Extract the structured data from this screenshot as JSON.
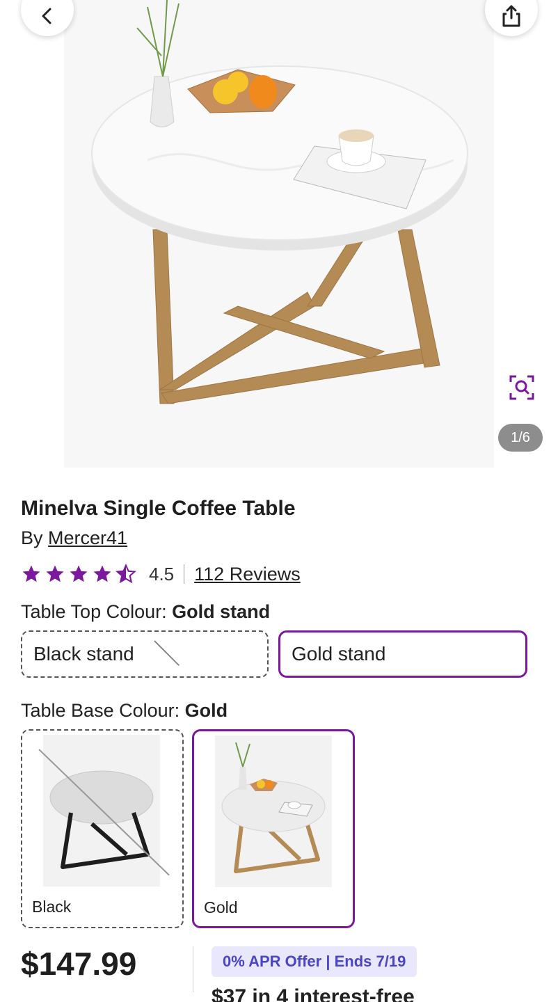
{
  "colors": {
    "accent": "#7b189f",
    "apr_text": "#4a44c6",
    "apr_bg": "#e8e7fb",
    "star": "#7b189f"
  },
  "hero": {
    "back_icon": "chevron-left-icon",
    "share_icon": "share-icon",
    "zoom_icon": "visual-search-icon",
    "image_counter": "1/6"
  },
  "product": {
    "title": "Minelva Single Coffee Table",
    "by_prefix": "By",
    "brand": "Mercer41",
    "rating": "4.5",
    "rating_value": 4.5,
    "rating_max": 5,
    "reviews": "112 Reviews"
  },
  "options": {
    "top_colour": {
      "label": "Table Top Colour:",
      "selected": "Gold stand",
      "choices": [
        "Black stand",
        "Gold stand"
      ]
    },
    "base_colour": {
      "label": "Table Base Colour:",
      "selected": "Gold",
      "choices": [
        "Black",
        "Gold"
      ]
    }
  },
  "pricing": {
    "price": "$147.99",
    "apr_offer": "0% APR Offer | Ends 7/19",
    "installments": "$37 in 4 interest-free"
  }
}
